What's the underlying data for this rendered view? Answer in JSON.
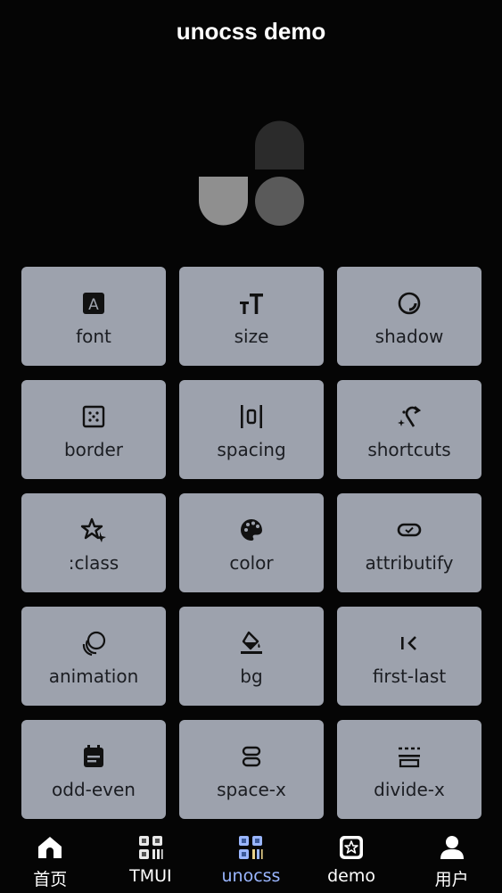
{
  "header": {
    "title": "unocss demo"
  },
  "colors": {
    "card_bg": "#9da2ad",
    "active_tab": "#9ab6ff",
    "background": "#050505"
  },
  "cards": [
    {
      "label": "font",
      "icon": "font-letter-icon"
    },
    {
      "label": "size",
      "icon": "text-size-icon"
    },
    {
      "label": "shadow",
      "icon": "shadow-circle-icon"
    },
    {
      "label": "border",
      "icon": "border-dots-icon"
    },
    {
      "label": "spacing",
      "icon": "spacing-icon"
    },
    {
      "label": "shortcuts",
      "icon": "magic-wand-icon"
    },
    {
      "label": ":class",
      "icon": "star-class-icon"
    },
    {
      "label": "color",
      "icon": "palette-icon"
    },
    {
      "label": "attributify",
      "icon": "toggle-pill-icon"
    },
    {
      "label": "animation",
      "icon": "bubbles-icon"
    },
    {
      "label": "bg",
      "icon": "paint-bucket-icon"
    },
    {
      "label": "first-last",
      "icon": "chevron-first-icon"
    },
    {
      "label": "odd-even",
      "icon": "calendar-note-icon"
    },
    {
      "label": "space-x",
      "icon": "stacked-rows-icon"
    },
    {
      "label": "divide-x",
      "icon": "divide-icon"
    }
  ],
  "tabs": [
    {
      "label": "首页",
      "icon": "home-icon"
    },
    {
      "label": "TMUI",
      "icon": "grid-apps-icon"
    },
    {
      "label": "unocss",
      "icon": "grid-apps-color-icon",
      "active": true
    },
    {
      "label": "demo",
      "icon": "star-card-icon"
    },
    {
      "label": "用户",
      "icon": "user-icon"
    }
  ]
}
